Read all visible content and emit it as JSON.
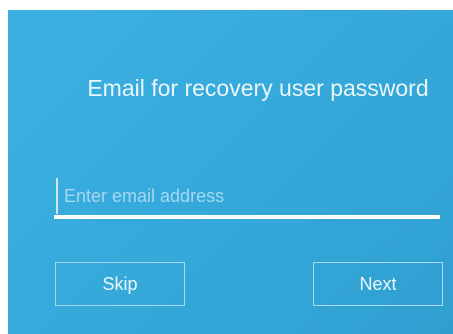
{
  "recovery": {
    "title": "Email for recovery user password",
    "email": {
      "value": "",
      "placeholder": "Enter email address"
    },
    "skip_label": "Skip",
    "next_label": "Next"
  },
  "colors": {
    "panel_background": "#36aadc",
    "text": "#ffffff",
    "placeholder": "#a6d7f0",
    "button_border": "#a9d9f1"
  }
}
